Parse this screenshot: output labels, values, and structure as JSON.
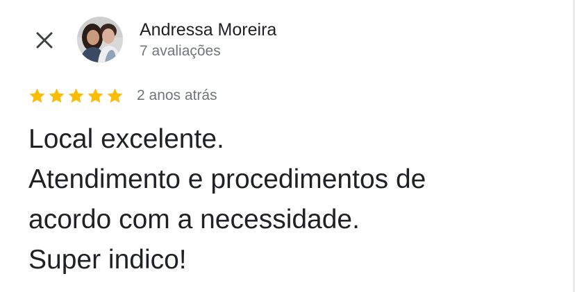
{
  "reviewer": {
    "name": "Andressa Moreira",
    "review_count": "7 avaliações"
  },
  "review": {
    "rating": 5,
    "rating_max": 5,
    "date": "2 anos atrás",
    "lines": [
      "Local excelente.",
      "Atendimento e procedimentos de",
      "acordo com a necessidade.",
      "Super indico!"
    ]
  },
  "icons": {
    "close": "close-icon",
    "star": "star-icon"
  },
  "colors": {
    "star": "#fbbc04",
    "primary_text": "#202124",
    "secondary_text": "#70757a",
    "background": "#ffffff"
  }
}
